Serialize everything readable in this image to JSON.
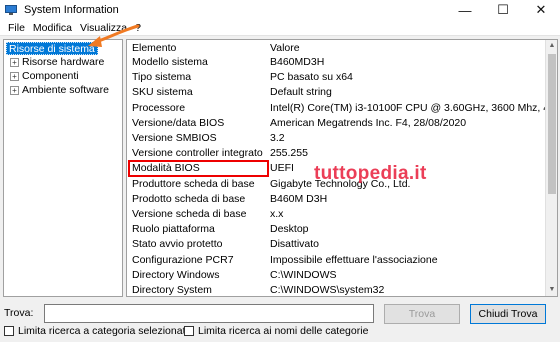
{
  "window": {
    "title": "System Information",
    "minimize": "—",
    "maximize": "☐",
    "close": "✕"
  },
  "menu": [
    "File",
    "Modifica",
    "Visualizza",
    "?"
  ],
  "tree": {
    "root": "Risorse di sistema",
    "children": [
      "Risorse hardware",
      "Componenti",
      "Ambiente software"
    ],
    "expander": "+"
  },
  "list": {
    "headers": {
      "name": "Elemento",
      "value": "Valore"
    },
    "rows": [
      {
        "name": "Modello sistema",
        "value": "B460MD3H"
      },
      {
        "name": "Tipo sistema",
        "value": "PC basato su x64"
      },
      {
        "name": "SKU sistema",
        "value": "Default string"
      },
      {
        "name": "Processore",
        "value": "Intel(R) Core(TM) i3-10100F CPU @ 3.60GHz, 3600 Mhz, 4 core, 8 pr"
      },
      {
        "name": "Versione/data BIOS",
        "value": "American Megatrends Inc. F4, 28/08/2020"
      },
      {
        "name": "Versione SMBIOS",
        "value": "3.2"
      },
      {
        "name": "Versione controller integrato",
        "value": "255.255"
      },
      {
        "name": "Modalità BIOS",
        "value": "UEFI"
      },
      {
        "name": "Produttore scheda di base",
        "value": "Gigabyte Technology Co., Ltd."
      },
      {
        "name": "Prodotto scheda di base",
        "value": "B460M D3H"
      },
      {
        "name": "Versione scheda di base",
        "value": "x.x"
      },
      {
        "name": "Ruolo piattaforma",
        "value": "Desktop"
      },
      {
        "name": "Stato avvio protetto",
        "value": "Disattivato"
      },
      {
        "name": "Configurazione PCR7",
        "value": "Impossibile effettuare l'associazione"
      },
      {
        "name": "Directory Windows",
        "value": "C:\\WINDOWS"
      },
      {
        "name": "Directory System",
        "value": "C:\\WINDOWS\\system32"
      }
    ]
  },
  "watermark": "tuttopedia.it",
  "search": {
    "label": "Trova:",
    "value": "",
    "find_button": "Trova",
    "close_button": "Chiudi Trova",
    "check_selected": "Limita ricerca a categoria selezionata",
    "check_names": "Limita ricerca ai nomi delle categorie"
  },
  "colors": {
    "selection": "#0078d7",
    "highlight": "#ee0000",
    "arrow": "#f07a23",
    "watermark": "#e81d3a"
  },
  "icons": {
    "app": "system-information-icon",
    "scroll_up": "▲",
    "scroll_down": "▼"
  }
}
